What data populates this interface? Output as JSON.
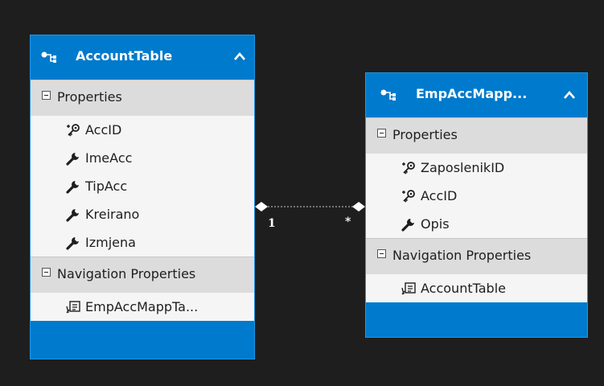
{
  "entities": [
    {
      "title": "AccountTable",
      "properties_label": "Properties",
      "properties": [
        {
          "name": "AccID",
          "icon": "key-icon"
        },
        {
          "name": "ImeAcc",
          "icon": "wrench-icon"
        },
        {
          "name": "TipAcc",
          "icon": "wrench-icon"
        },
        {
          "name": "Kreirano",
          "icon": "wrench-icon"
        },
        {
          "name": "Izmjena",
          "icon": "wrench-icon"
        }
      ],
      "nav_label": "Navigation Properties",
      "nav_items": [
        {
          "name": "EmpAccMappTa...",
          "icon": "navigation-property-icon"
        }
      ]
    },
    {
      "title": "EmpAccMapp...",
      "properties_label": "Properties",
      "properties": [
        {
          "name": "ZaposlenikID",
          "icon": "key-icon"
        },
        {
          "name": "AccID",
          "icon": "key-icon"
        },
        {
          "name": "Opis",
          "icon": "wrench-icon"
        }
      ],
      "nav_label": "Navigation Properties",
      "nav_items": [
        {
          "name": "AccountTable",
          "icon": "navigation-property-icon"
        }
      ]
    }
  ],
  "association": {
    "left_multiplicity": "1",
    "right_multiplicity": "*"
  },
  "colors": {
    "background": "#1e1e1e",
    "entity_header": "#007acc",
    "section_header": "#dcdcdc",
    "item_background": "#f5f5f5"
  }
}
